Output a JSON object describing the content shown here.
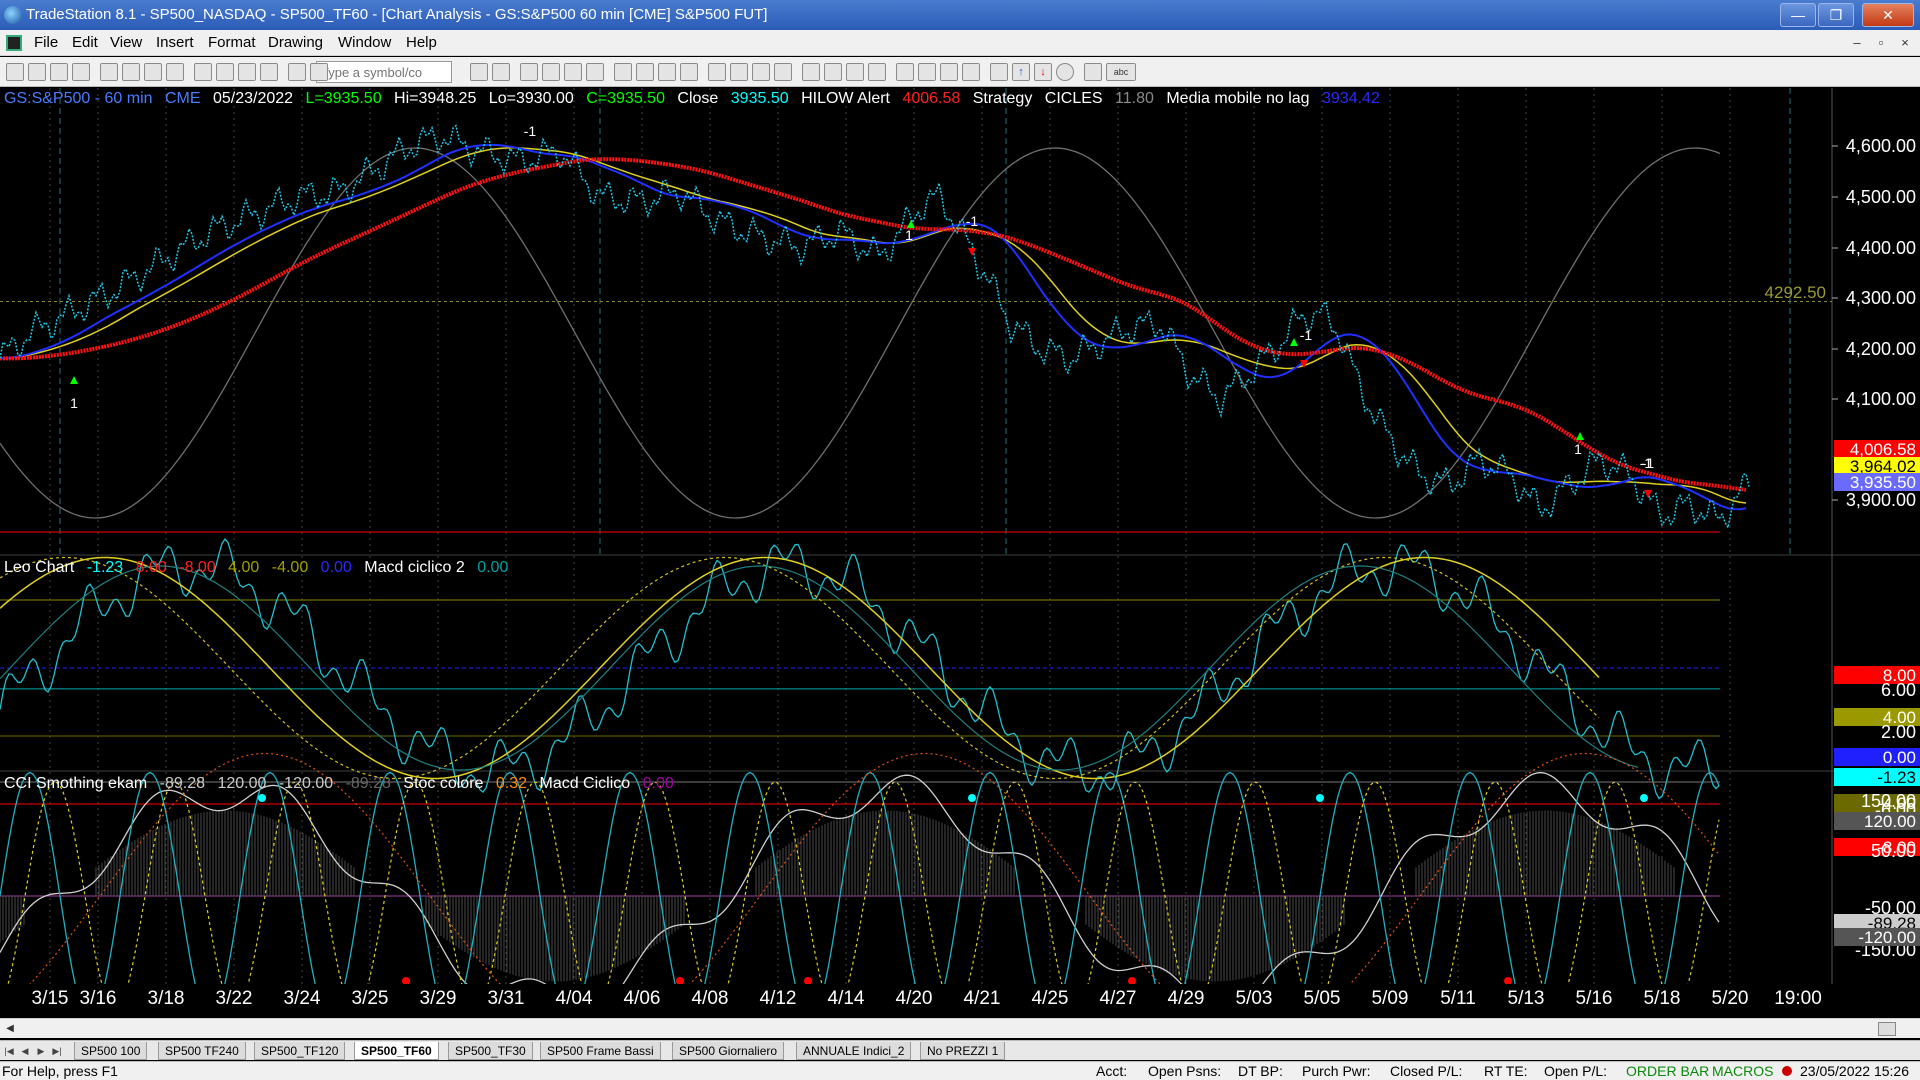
{
  "window": {
    "title": "TradeStation 8.1 - SP500_NASDAQ - SP500_TF60 - [Chart Analysis - GS:S&P500  60 min  [CME] S&P500 FUT]",
    "minimize": "—",
    "maximize": "❐",
    "close": "✕"
  },
  "menu": [
    "File",
    "Edit",
    "View",
    "Insert",
    "Format",
    "Drawing",
    "Window",
    "Help"
  ],
  "mdi": {
    "minimize": "–",
    "restore": "▫",
    "close": "×"
  },
  "toolbar": {
    "symbol_placeholder": "Type a symbol/co",
    "text_tool": "abc"
  },
  "header1": {
    "symbol": "GS:S&P500 - 60 min",
    "exchange": "CME",
    "date": "05/23/2022",
    "last": "L=3935.50",
    "high": "Hi=3948.25",
    "low": "Lo=3930.00",
    "close_val": "C=3935.50",
    "close_label": "Close",
    "close_num": "3935.50",
    "hilow_label": "HILOW Alert",
    "hilow_num": "4006.58",
    "strategy_label": "Strategy",
    "cicles_label": "CICLES",
    "cicles_num": "11.80",
    "media_label": "Media mobile no lag",
    "media_num": "3934.42"
  },
  "header2": {
    "label": "Leo Chart",
    "v1": "-1.23",
    "v2": "8.00",
    "v3": "-8.00",
    "v4": "4.00",
    "v5": "-4.00",
    "v6": "0.00",
    "macd_label": "Macd ciclico 2",
    "macd_num": "0.00"
  },
  "header3": {
    "label": "CCI Smothing ekam",
    "v1": "-89.28",
    "v2": "120.00",
    "v3": "-120.00",
    "v4": "-89.28",
    "stoc_label": "Stoc colore",
    "stoc_num": "0.32",
    "macd_label": "Macd Ciclico",
    "macd_num": "0.00"
  },
  "price_axis": {
    "ticks": [
      "4,600.00",
      "4,500.00",
      "4,400.00",
      "4,300.00",
      "4,200.00",
      "4,100.00",
      "3,900.00"
    ],
    "level_label": "4292.50",
    "badges": [
      {
        "label": "4,006.58",
        "bg": "#ff0000",
        "fg": "#ffffff"
      },
      {
        "label": "3,964.02",
        "bg": "#ffff00",
        "fg": "#000000"
      },
      {
        "label": "3,935.50",
        "bg": "#6a6aff",
        "fg": "#ffffff"
      }
    ]
  },
  "osc_axis": {
    "ticks": [
      "6.00",
      "2.00",
      "-6.00"
    ],
    "badges": [
      {
        "label": "8.00",
        "bg": "#ff0000",
        "fg": "#ffffff"
      },
      {
        "label": "4.00",
        "bg": "#9a9a00",
        "fg": "#ffffff"
      },
      {
        "label": "0.00",
        "bg": "#2020ff",
        "fg": "#ffffff"
      },
      {
        "label": "-1.23",
        "bg": "#00ffff",
        "fg": "#000000"
      },
      {
        "label": "-4.00",
        "bg": "#6a6a00",
        "fg": "#ffffff"
      },
      {
        "label": "-8.00",
        "bg": "#ff0000",
        "fg": "#ffffff"
      }
    ]
  },
  "cci_axis": {
    "ticks": [
      "150.00",
      "50.00",
      "-50.00",
      "-150.00"
    ],
    "badges": [
      {
        "label": "120.00",
        "bg": "#555555",
        "fg": "#ffffff"
      },
      {
        "label": "-89.28",
        "bg": "#cccccc",
        "fg": "#000000"
      },
      {
        "label": "-120.00",
        "bg": "#555555",
        "fg": "#ffffff"
      }
    ]
  },
  "dates": [
    "3/15",
    "3/16",
    "3/18",
    "3/22",
    "3/24",
    "3/25",
    "3/29",
    "3/31",
    "4/04",
    "4/06",
    "4/08",
    "4/12",
    "4/14",
    "4/20",
    "4/21",
    "4/25",
    "4/27",
    "4/29",
    "5/03",
    "5/05",
    "5/09",
    "5/11",
    "5/13",
    "5/16",
    "5/18",
    "5/20",
    "19:00"
  ],
  "signals": [
    "1",
    "-1",
    "1",
    "-1",
    "-1",
    "-1",
    "1",
    "-1"
  ],
  "tabs": [
    "SP500 100",
    "SP500 TF240",
    "SP500_TF120",
    "SP500_TF60",
    "SP500_TF30",
    "SP500 Frame Bassi",
    "SP500 Giornaliero",
    "ANNUALE Indici_2",
    "No PREZZI 1"
  ],
  "active_tab": "SP500_TF60",
  "status": {
    "help": "For Help, press F1",
    "acct": "Acct:",
    "open_psns": "Open Psns:",
    "dt_bp": "DT BP:",
    "purch_pwr": "Purch Pwr:",
    "closed_pl": "Closed P/L:",
    "rt_te": "RT TE:",
    "open_pl": "Open P/L:",
    "order_bar": "ORDER BAR",
    "macros": "MACROS",
    "datetime": "23/05/2022 15:26"
  }
}
